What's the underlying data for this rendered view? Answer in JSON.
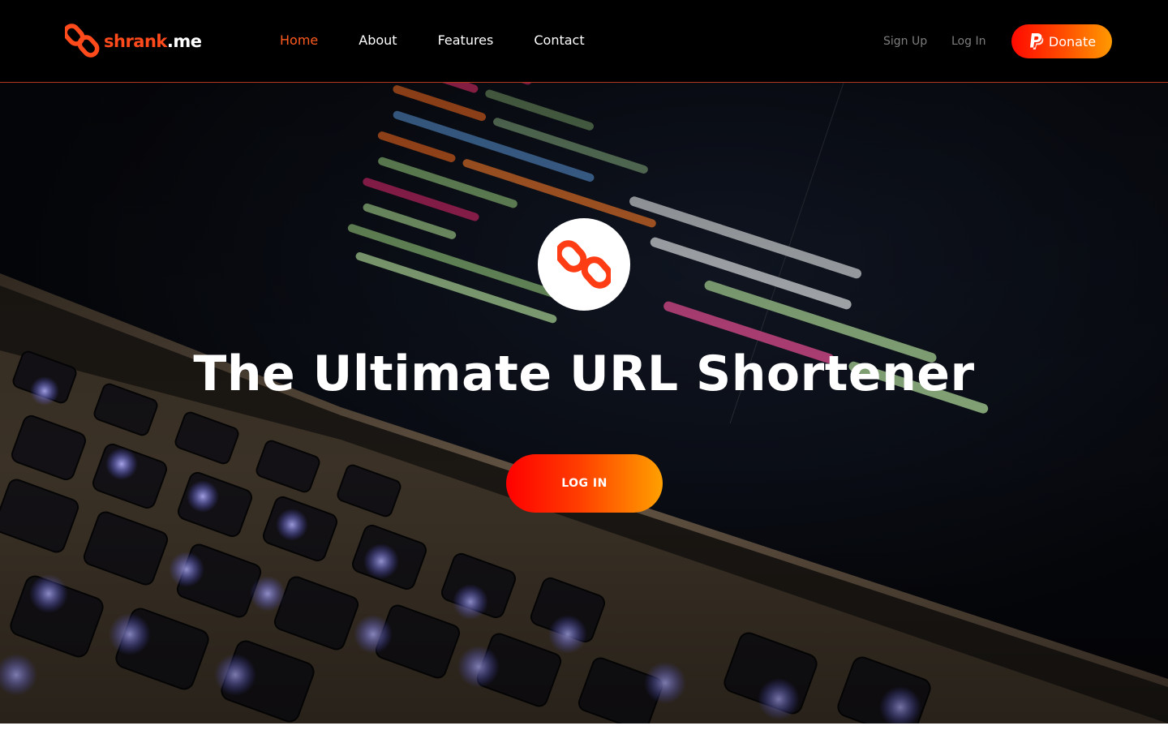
{
  "header": {
    "brand": {
      "name_part1": "shrank",
      "name_part2": ".me",
      "icon": "chain-link-icon"
    },
    "nav": [
      {
        "label": "Home",
        "active": true
      },
      {
        "label": "About",
        "active": false
      },
      {
        "label": "Features",
        "active": false
      },
      {
        "label": "Contact",
        "active": false
      }
    ],
    "auth": {
      "signup_label": "Sign Up",
      "login_label": "Log In"
    },
    "donate": {
      "label": "Donate",
      "icon": "paypal-icon"
    }
  },
  "hero": {
    "logo_icon": "chain-link-icon",
    "title": "The Ultimate URL Shortener",
    "cta_label": "LOG IN",
    "background": "laptop-code-photo"
  },
  "colors": {
    "accent": "#ff5a1f",
    "brand_orange": "#ff4a1c",
    "gradient_start": "#ff0000",
    "gradient_end": "#ffa000",
    "header_bg": "#000000",
    "muted_text": "#7e7e7e"
  }
}
